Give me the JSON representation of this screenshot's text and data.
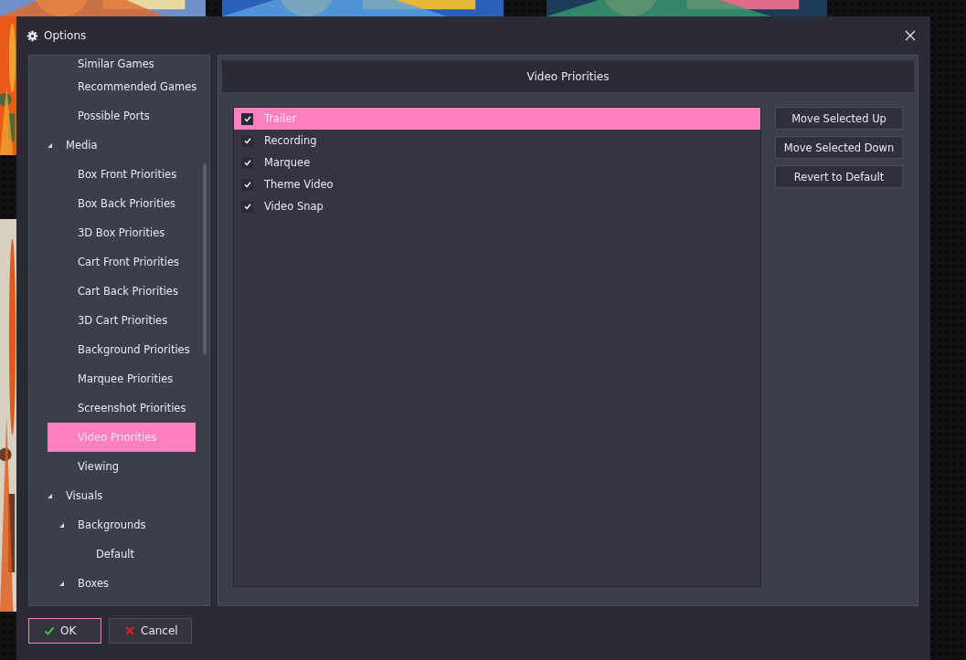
{
  "window": {
    "title": "Options"
  },
  "tree": [
    {
      "children": [
        {
          "label": "Similar Games",
          "selected": false
        },
        {
          "label": "Recommended Games",
          "selected": false
        },
        {
          "label": "Possible Ports",
          "selected": false
        }
      ]
    },
    {
      "label": "Media",
      "selected": false,
      "expanded": true,
      "children": [
        {
          "label": "Box Front Priorities",
          "selected": false
        },
        {
          "label": "Box Back Priorities",
          "selected": false
        },
        {
          "label": "3D Box Priorities",
          "selected": false
        },
        {
          "label": "Cart Front Priorities",
          "selected": false
        },
        {
          "label": "Cart Back Priorities",
          "selected": false
        },
        {
          "label": "3D Cart Priorities",
          "selected": false
        },
        {
          "label": "Background Priorities",
          "selected": false
        },
        {
          "label": "Marquee Priorities",
          "selected": false
        },
        {
          "label": "Screenshot Priorities",
          "selected": false
        },
        {
          "label": "Video Priorities",
          "selected": true
        },
        {
          "label": "Viewing",
          "selected": false
        }
      ]
    },
    {
      "label": "Visuals",
      "selected": false,
      "expanded": true,
      "children": [
        {
          "label": "Backgrounds",
          "selected": false,
          "expanded": true,
          "children": [
            {
              "label": "Default",
              "selected": false
            }
          ]
        },
        {
          "label": "Boxes",
          "selected": false,
          "expanded": true
        }
      ]
    }
  ],
  "panel": {
    "title": "Video Priorities",
    "items": [
      {
        "label": "Trailer",
        "checked": true,
        "selected": true
      },
      {
        "label": "Recording",
        "checked": true,
        "selected": false
      },
      {
        "label": "Marquee",
        "checked": true,
        "selected": false
      },
      {
        "label": "Theme Video",
        "checked": true,
        "selected": false
      },
      {
        "label": "Video Snap",
        "checked": true,
        "selected": false
      }
    ],
    "buttons": [
      "Move Selected Up",
      "Move Selected Down",
      "Revert to Default"
    ]
  },
  "footer": {
    "ok": "OK",
    "cancel": "Cancel"
  }
}
